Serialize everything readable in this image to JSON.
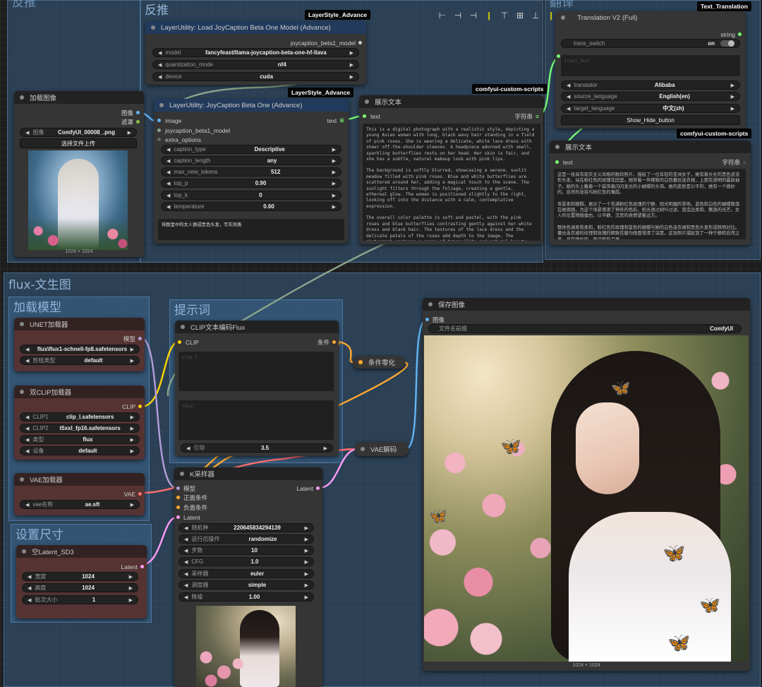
{
  "colors": {
    "clip_wire": "#ffd500",
    "conditioning_wire": "#ffa931",
    "model_wire": "#b39ddb",
    "vae_wire": "#ff6e6e",
    "latent_wire": "#ff9cf9",
    "image_wire": "#64b5f6",
    "string_wire": "#77ff77",
    "ui_link": "#8ba68b"
  },
  "toolbar": {
    "icons": [
      "align-left-icon",
      "align-center-h-icon",
      "align-right-icon",
      "separator-icon",
      "align-top-icon",
      "align-middle-v-icon",
      "align-bottom-icon",
      "separator-icon",
      "distribute-h-icon",
      "distribute-v-icon",
      "separator-icon",
      "equal-width-icon",
      "equal-height-icon"
    ]
  },
  "groups": {
    "reverse_left": "反推",
    "reverse_right": "反推",
    "translate": "翻译",
    "flux": "flux-文生图",
    "load_model": "加载模型",
    "prompt": "提示词",
    "set_size": "设置尺寸"
  },
  "tags": {
    "layerstyle1": "LayerStyle_Advance",
    "layerstyle2": "LayerStyle_Advance",
    "custom1": "comfyui-custom-scripts",
    "custom2": "comfyui-custom-scripts",
    "text_translation": "Text_Translation"
  },
  "load_image": {
    "title": "加载图像",
    "out_image": "图像",
    "out_mask": "遮罩",
    "image_label": "图像",
    "image_value": "ComfyUI_00008_.png",
    "upload_button": "选择文件上传",
    "size": "1024 × 1024"
  },
  "load_joy_model": {
    "title": "LayerUtility: Load JoyCaption Beta One Model (Advance)",
    "output": "joycaption_beta1_model",
    "widgets": [
      {
        "label": "model",
        "value": "fancyfeast/llama-joycaption-beta-one-hf-llava"
      },
      {
        "label": "quantization_mode",
        "value": "nf4"
      },
      {
        "label": "device",
        "value": "cuda"
      }
    ]
  },
  "joy_caption": {
    "title": "LayerUtility: JoyCaption Beta One (Advance)",
    "in_image": "image",
    "in_model": "joycaption_beta1_model",
    "in_extra": "extra_options",
    "output": "text",
    "widgets": [
      {
        "label": "caption_type",
        "value": "Descriptive"
      },
      {
        "label": "caption_length",
        "value": "any"
      },
      {
        "label": "max_new_tokens",
        "value": "512"
      },
      {
        "label": "top_p",
        "value": "0.90"
      },
      {
        "label": "top_k",
        "value": "0"
      },
      {
        "label": "temperature",
        "value": "0.60"
      }
    ],
    "user_prompt": "将图里中的女人换成黑色头发，写实风格"
  },
  "show_text_1": {
    "title": "展示文本",
    "input": "text",
    "output": "字符串",
    "paragraphs": [
      "This is a digital photograph with a realistic style, depicting a young Asian woman with long, black wavy hair standing in a field of pink roses. She is wearing a delicate, white lace dress with sheer off-the-shoulder sleeves. A headpiece adorned with small, sparkling butterflies rests on her head. Her skin is fair, and she has a subtle, natural makeup look with pink lips.",
      "The background is softly blurred, showcasing a serene, sunlit meadow filled with pink roses. Blue and white butterflies are scattered around her, adding a magical touch to the scene. The sunlight filters through the foliage, creating a gentle, ethereal glow. The woman is positioned slightly to the right, looking off into the distance with a calm, contemplative expression.",
      "The overall color palette is soft and pastel, with the pink roses and blue butterflies contrasting gently against her white dress and black hair. The textures of the lace dress and the delicate petals of the roses add depth to the image. The photograph captures a sense of tranquility and natural beauty, with a subtle, fairy-tale-like quality."
    ]
  },
  "translation": {
    "title": "Translation V2 (Full)",
    "title_prefix": "a",
    "output": "string",
    "switch_label": "trans_switch",
    "switch_value": "on",
    "text_placeholder": "trans_text",
    "widgets": [
      {
        "label": "translator",
        "value": "Alibaba"
      },
      {
        "label": "source_language",
        "value": "English(en)"
      },
      {
        "label": "target_language",
        "value": "中文(zh)"
      }
    ],
    "button": "Show_Hide_button"
  },
  "show_text_2": {
    "title": "展示文本",
    "input": "text",
    "output": "字符串",
    "paragraphs": [
      "这是一张具有现实主义风格的数码照片，描绘了一位年轻的亚洲女子，她有着长长的黑色波浪形头发，站在粉红色的玫瑰花田里。她穿着一件精致的白色蕾丝连衣裙，上面有透明的露肩袖子。她的头上戴着一个装饰着闪闪发光的小蝴蝶的头饰。她的皮肤是公平的，她有一个微妙的，自然的妆容与粉红色的嘴唇。",
      "背景柔和模糊，展示了一个充满粉红色玫瑰的宁静、阳光明媚的草地。蓝色和白色的蝴蝶散落在她周围，为这个场景增添了神奇的色彩。阳光透过树叶过滤，营造出柔和、飘逸的光芒。女人的位置稍微偏右，以平静、沉思的表情望着远方。",
      "整体色调柔和柔和，粉红色的玫瑰和蓝色的蝴蝶与她的白色连衣裙和黑色头发形成鲜明对比。蕾丝连衣裙的纹理和玫瑰的精致花瓣为画面增添了深度。这张照片捕捉到了一种宁静和自然之美，具有微妙的、童话般的品质。"
    ]
  },
  "unet_loader": {
    "title": "UNET加载器",
    "output": "模型",
    "widgets": [
      {
        "label": "",
        "value": "flux\\flux1-schnell-fp8.safetensors"
      },
      {
        "label": "剪枝类型",
        "value": "default"
      }
    ]
  },
  "dual_clip": {
    "title": "双CLIP加载器",
    "output": "CLIP",
    "widgets": [
      {
        "label": "CLIP1",
        "value": "clip_l.safetensors"
      },
      {
        "label": "CLIP2",
        "value": "t5xxl_fp16.safetensors"
      },
      {
        "label": "类型",
        "value": "flux"
      },
      {
        "label": "设备",
        "value": "default"
      }
    ]
  },
  "vae_loader": {
    "title": "VAE加载器",
    "output": "VAE",
    "widgets": [
      {
        "label": "vae名称",
        "value": "ae.sft"
      }
    ]
  },
  "empty_latent": {
    "title": "空Latent_SD3",
    "output": "Latent",
    "widgets": [
      {
        "label": "宽度",
        "value": "1024"
      },
      {
        "label": "高度",
        "value": "1024"
      },
      {
        "label": "批次大小",
        "value": "1"
      }
    ]
  },
  "clip_encode": {
    "title": "CLIP文本编码Flux",
    "input": "CLIP",
    "output": "条件",
    "clip_l_placeholder": "clip_l",
    "t5xxl_placeholder": "t5xxl",
    "guidance_label": "引导",
    "guidance_value": "3.5"
  },
  "cond_zero": {
    "title": "条件零化"
  },
  "vae_decode": {
    "title": "VAE解码"
  },
  "ksampler": {
    "title": "K采样器",
    "inputs": [
      "模型",
      "正面条件",
      "负面条件",
      "Latent"
    ],
    "output": "Latent",
    "widgets": [
      {
        "label": "随机种",
        "value": "220645834294139"
      },
      {
        "label": "运行后操作",
        "value": "randomize"
      },
      {
        "label": "步数",
        "value": "10"
      },
      {
        "label": "CFG",
        "value": "1.0"
      },
      {
        "label": "采样器",
        "value": "euler"
      },
      {
        "label": "调度器",
        "value": "simple"
      },
      {
        "label": "降噪",
        "value": "1.00"
      }
    ]
  },
  "save_image": {
    "title": "保存图像",
    "input": "图像",
    "prefix_label": "文件名前缀",
    "prefix_value": "ComfyUI",
    "size": "1024 × 1024"
  }
}
